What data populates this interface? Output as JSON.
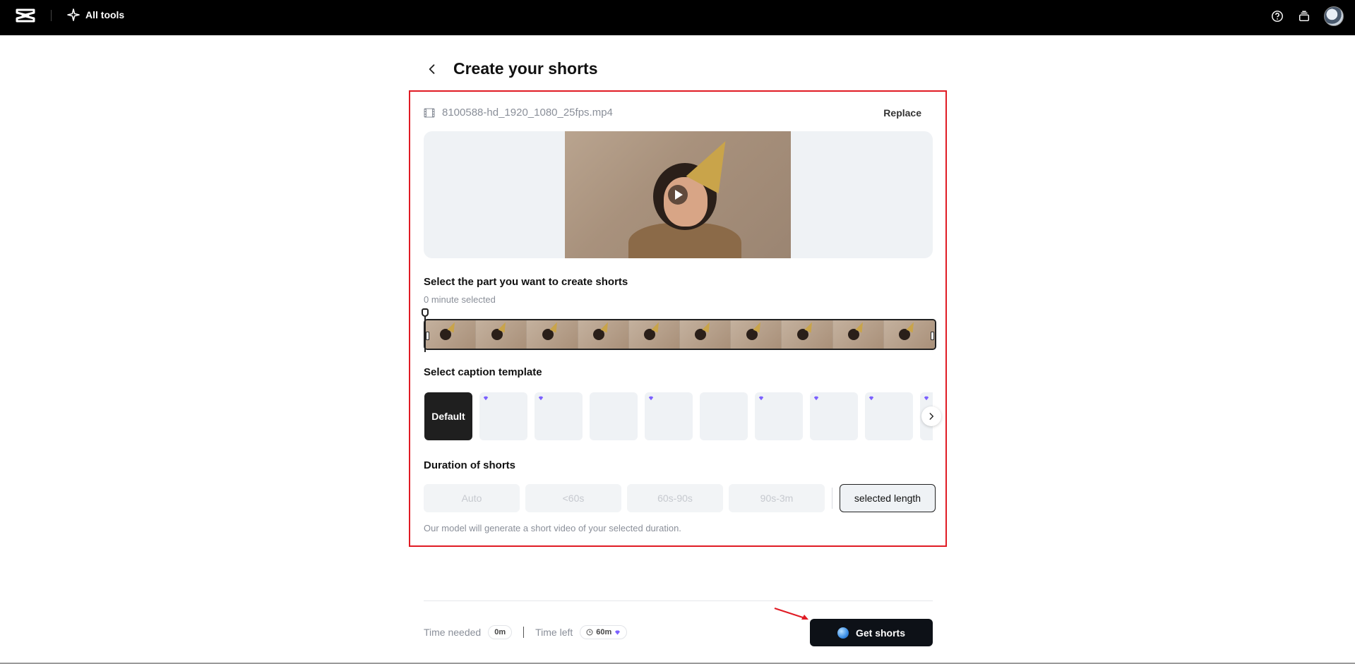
{
  "topbar": {
    "all_tools_label": "All tools"
  },
  "header": {
    "title": "Create your shorts"
  },
  "file": {
    "name": "8100588-hd_1920_1080_25fps.mp4",
    "replace_label": "Replace"
  },
  "selection": {
    "title": "Select the part you want to create shorts",
    "status": "0 minute selected"
  },
  "captions": {
    "title": "Select caption template",
    "default_label": "Default",
    "templates": [
      {
        "premium": true
      },
      {
        "premium": true
      },
      {
        "premium": false
      },
      {
        "premium": true
      },
      {
        "premium": false
      },
      {
        "premium": true
      },
      {
        "premium": true
      },
      {
        "premium": true
      },
      {
        "premium": true
      }
    ]
  },
  "duration": {
    "title": "Duration of shorts",
    "options": [
      "Auto",
      "<60s",
      "60s-90s",
      "90s-3m"
    ],
    "selected_label": "selected length",
    "note": "Our model will generate a short video of your selected duration."
  },
  "footer": {
    "time_needed_label": "Time needed",
    "time_needed_value": "0m",
    "time_left_label": "Time left",
    "time_left_value": "60m",
    "cta_label": "Get shorts"
  },
  "colors": {
    "highlight": "#e01b24",
    "premium_gem": "#7b61ff",
    "cta_bg": "#0d1117"
  }
}
